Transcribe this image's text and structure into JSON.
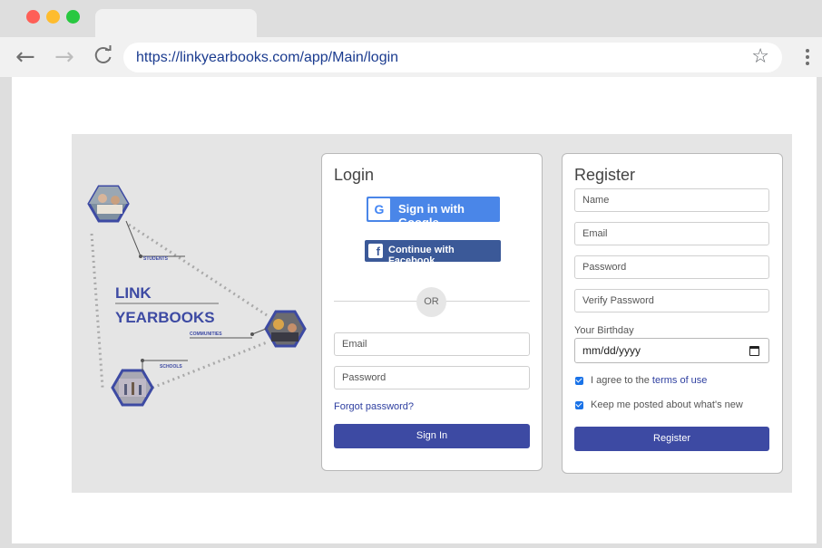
{
  "browser": {
    "url": "https://linkyearbooks.com/app/Main/login",
    "back_icon": "←",
    "forward_icon": "→",
    "reload_icon": "C",
    "star_icon": "☆"
  },
  "brand": {
    "line1": "LINK",
    "line2": "YEARBOOKS",
    "students": "STUDENTS",
    "communities": "COMMUNITIES",
    "schools": "SCHOOLS",
    "accent": "#3d4aa3"
  },
  "login": {
    "title": "Login",
    "google_label": "Sign in with Google",
    "google_icon": "G",
    "facebook_label": "Continue with Facebook",
    "facebook_icon": "f",
    "or_label": "OR",
    "email_placeholder": "Email",
    "password_placeholder": "Password",
    "forgot_label": "Forgot password?",
    "submit_label": "Sign In"
  },
  "register": {
    "title": "Register",
    "name_placeholder": "Name",
    "email_placeholder": "Email",
    "password_placeholder": "Password",
    "verify_placeholder": "Verify Password",
    "birthday_label": "Your Birthday",
    "birthday_value": "mm/dd/yyyy",
    "terms_prefix": "I agree to the ",
    "terms_link": "terms of use",
    "news_label": "Keep me posted about what's new",
    "submit_label": "Register"
  }
}
